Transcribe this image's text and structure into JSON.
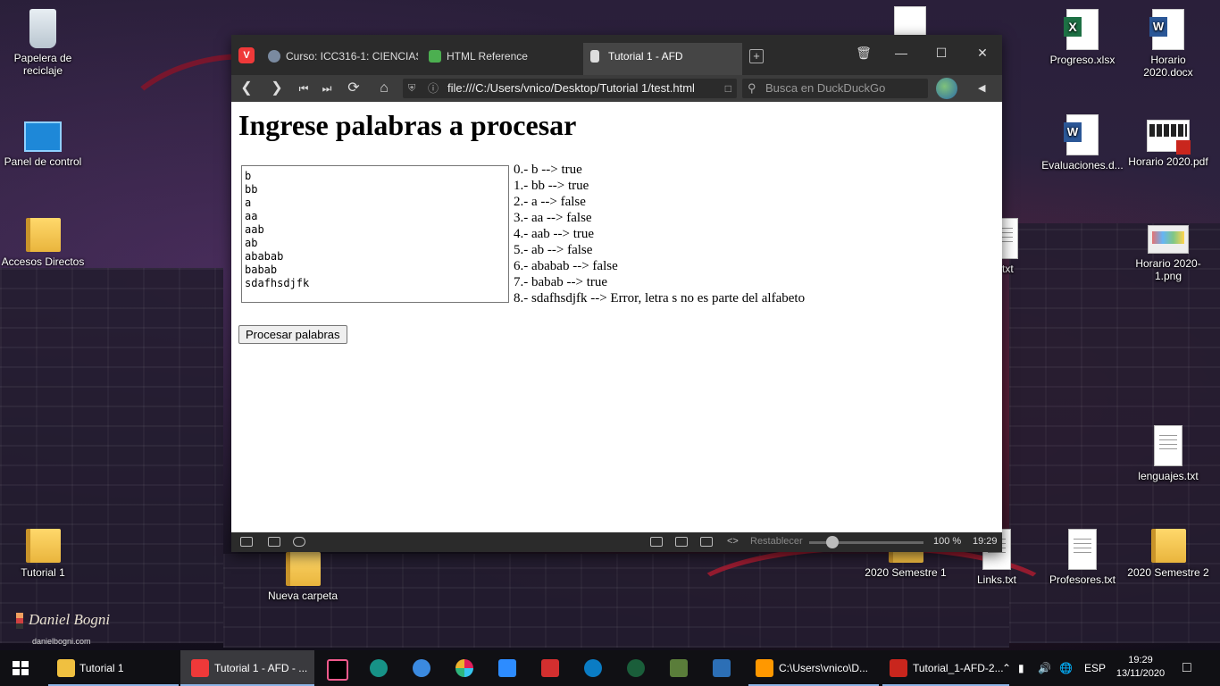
{
  "desktop": {
    "icons": [
      {
        "label": "Papelera de reciclaje",
        "icon": "recycle-bin-icon"
      },
      {
        "label": "Panel de control",
        "icon": "control-panel-icon"
      },
      {
        "label": "Accesos Directos",
        "icon": "folder-icon"
      },
      {
        "label": "Tutorial 1",
        "icon": "folder-icon"
      },
      {
        "label": "Nueva carpeta",
        "icon": "folder-icon"
      },
      {
        "label": "Progreso.xlsx",
        "icon": "excel-file-icon"
      },
      {
        "label": "Horario 2020.docx",
        "icon": "word-file-icon"
      },
      {
        "label": "Evaluaciones.d...",
        "icon": "word-file-icon"
      },
      {
        "label": "Horario 2020.pdf",
        "icon": "pdf-file-icon"
      },
      {
        "label": "Horario 2020-1.png",
        "icon": "image-file-icon"
      },
      {
        "label": "lenguajes.txt",
        "icon": "text-file-icon"
      },
      {
        "label": "2020 Semestre 1",
        "icon": "folder-icon"
      },
      {
        "label": "Links.txt",
        "icon": "text-file-icon"
      },
      {
        "label": "Profesores.txt",
        "icon": "text-file-icon"
      },
      {
        "label": "2020 Semestre 2",
        "icon": "folder-icon"
      },
      {
        "label": "txt",
        "icon": "text-file-icon"
      }
    ],
    "wallpaper_signature": "Daniel Bogni",
    "wallpaper_site": "danielbogni.com"
  },
  "browser": {
    "tabs": [
      {
        "label": "Curso: ICC316-1: CIENCIAS",
        "icon": "moodle-icon"
      },
      {
        "label": "HTML Reference",
        "icon": "w3schools-icon"
      },
      {
        "label": "Tutorial 1 - AFD",
        "icon": "page-icon",
        "active": true
      }
    ],
    "url": "file:///C:/Users/vnico/Desktop/Tutorial 1/test.html",
    "search_placeholder": "Busca en DuckDuckGo",
    "window_controls": {
      "minimize": "—",
      "maximize": "☐",
      "close": "✕"
    },
    "status": {
      "reset_label": "Restablecer",
      "zoom": "100 %",
      "time": "19:29",
      "zoom_fraction": 0.2
    }
  },
  "page": {
    "heading": "Ingrese palabras a procesar",
    "textarea_value": "b\nbb\na\naa\naab\nab\nababab\nbabab\nsdafhsdjfk",
    "results": [
      "0.- b --> true",
      "1.- bb --> true",
      "2.- a --> false",
      "3.- aa --> false",
      "4.- aab --> true",
      "5.- ab --> false",
      "6.- ababab --> false",
      "7.- babab --> true",
      "8.- sdafhsdjfk --> Error, letra s no es parte del alfabeto"
    ],
    "process_button": "Procesar palabras"
  },
  "taskbar": {
    "items": [
      {
        "label": "Tutorial 1",
        "icon": "folder-icon"
      },
      {
        "label": "Tutorial 1 - AFD - ...",
        "icon": "vivaldi-icon",
        "active": true
      },
      {
        "label": "C:\\Users\\vnico\\D...",
        "icon": "sublime-text-icon"
      },
      {
        "label": "Tutorial_1-AFD-2...",
        "icon": "pdf-reader-icon"
      }
    ],
    "pinned": [
      "intellij-icon",
      "gitkraken-icon",
      "thunderbird-icon",
      "slack-icon",
      "zoom-icon",
      "download-icon",
      "sync-icon",
      "hs-icon",
      "tool-icon",
      "dbeaver-icon"
    ],
    "language": "ESP",
    "time": "19:29",
    "date": "13/11/2020"
  }
}
